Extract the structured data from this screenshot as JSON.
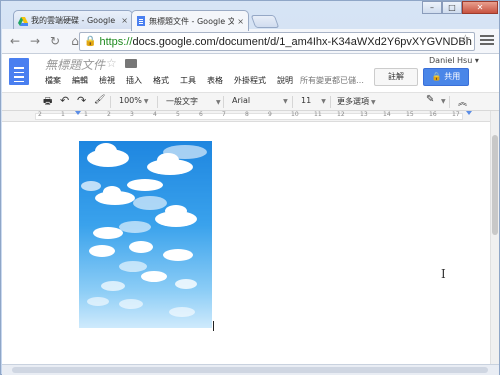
{
  "browser": {
    "tabs": [
      {
        "title": "我的雲端硬碟 - Google 雲",
        "close": "×"
      },
      {
        "title": "無標題文件 - Google 文",
        "close": "×"
      }
    ],
    "window_controls": {
      "minimize": "–",
      "maximize": "□",
      "close": "✕"
    },
    "nav": {
      "back": "←",
      "forward": "→",
      "reload": "↻",
      "home": "⌂"
    },
    "url": {
      "scheme": "https://",
      "rest": "docs.google.com/document/d/1_am4Ihx-K34aWXd2Y6pvXYGVNDBh"
    },
    "bookmark_star": "☆"
  },
  "docs": {
    "title": "無標題文件",
    "title_star": "☆",
    "menus": [
      "檔案",
      "編輯",
      "檢視",
      "插入",
      "格式",
      "工具",
      "表格",
      "外掛程式",
      "說明"
    ],
    "save_status": "所有變更都已儲…",
    "user": "Daniel Hsu ▾",
    "comment_label": "註解",
    "share_label": "🔒 共用"
  },
  "editor_toolbar": {
    "print": "🖶",
    "undo": "↶",
    "redo": "↷",
    "paint": "🖌",
    "zoom": "100%",
    "style": "一般文字",
    "font": "Arial",
    "size": "11",
    "more": "更多選項",
    "pen": "✎",
    "collapse": "︽"
  },
  "ruler": {
    "numbers": [
      "2",
      "1",
      "1",
      "2",
      "3",
      "4",
      "5",
      "6",
      "7",
      "8",
      "9",
      "10",
      "11",
      "12",
      "13",
      "14",
      "15",
      "16",
      "17"
    ]
  },
  "colors": {
    "docs_blue": "#4a7ff0",
    "share_blue": "#4a86e8",
    "sky_top": "#1e86e0",
    "sky_bottom": "#cfeafc"
  }
}
